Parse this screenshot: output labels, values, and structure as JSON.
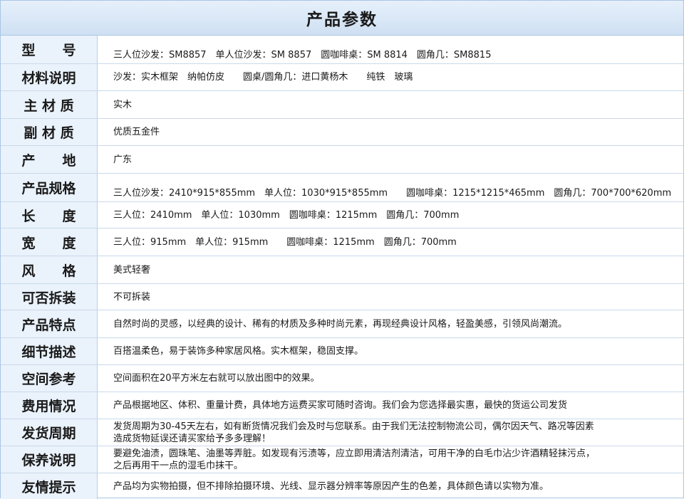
{
  "title": "产品参数",
  "rows": [
    {
      "label": "型　　号",
      "value": "三人位沙发：SM8857　单人位沙发：SM 8857　圆咖啡桌：SM 8814　圆角几：SM8815"
    },
    {
      "label": "材料说明",
      "value": "沙发：实木框架　纳帕仿皮　　圆桌/圆角几：进口黄杨木　　纯铁　玻璃"
    },
    {
      "label": "主 材 质",
      "value": "实木"
    },
    {
      "label": "副 材 质",
      "value": "优质五金件"
    },
    {
      "label": "产　　地",
      "value": "广东"
    },
    {
      "label": "产品规格",
      "value": "三人位沙发：2410*915*855mm　单人位：1030*915*855mm　　圆咖啡桌：1215*1215*465mm　圆角几：700*700*620mm"
    },
    {
      "label": "长　　度",
      "value": "三人位：2410mm　单人位：1030mm　圆咖啡桌：1215mm　圆角几：700mm"
    },
    {
      "label": "宽　　度",
      "value": "三人位：915mm　单人位：915mm　　圆咖啡桌：1215mm　圆角几：700mm"
    },
    {
      "label": "风　　格",
      "value": "美式轻奢"
    },
    {
      "label": "可否拆装",
      "value": "不可拆装"
    },
    {
      "label": "产品特点",
      "value": "自然时尚的灵感，以经典的设计、稀有的材质及多种时尚元素，再现经典设计风格，轻盈美感，引领风尚潮流。"
    },
    {
      "label": "细节描述",
      "value": "百搭温柔色，易于装饰多种家居风格。实木框架，稳固支撑。"
    },
    {
      "label": "空间参考",
      "value": "空间面积在20平方米左右就可以放出图中的效果。"
    },
    {
      "label": "费用情况",
      "value": "产品根据地区、体积、重量计费，具体地方运费买家可随时咨询。我们会为您选择最实惠，最快的货运公司发货"
    },
    {
      "label": "发货周期",
      "value": "发货周期为30-45天左右，如有断货情况我们会及时与您联系。由于我们无法控制物流公司，偶尔因天气、路况等因素\n造成货物延误还请买家给予多多理解！"
    },
    {
      "label": "保养说明",
      "value": "要避免油渍，圆珠笔、油墨等弄脏。如发现有污渍等，应立即用清洁剂清洁，可用干净的白毛巾沾少许酒精轻抹污点，\n之后再用干一点的湿毛巾抹干。"
    },
    {
      "label": "友情提示",
      "value": "产品均为实物拍摄，但不排除拍摄环境、光线、显示器分辨率等原因产生的色差，具体颜色请以实物为准。"
    }
  ]
}
